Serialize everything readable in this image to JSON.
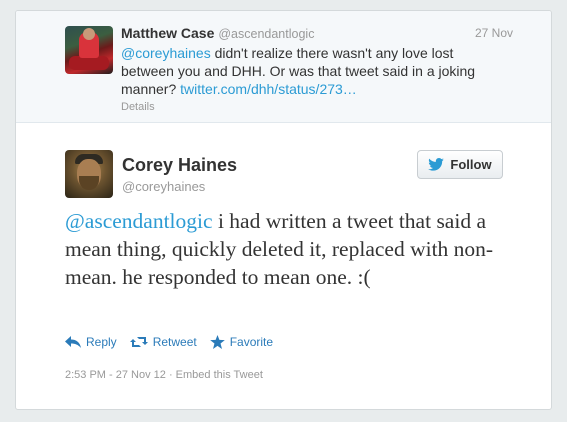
{
  "parent_tweet": {
    "author_name": "Matthew Case",
    "author_handle": "@ascendantlogic",
    "date": "27 Nov",
    "mention": "@coreyhaines",
    "text": " didn't realize there wasn't any love lost between you and DHH. Or was that tweet said in a joking manner? ",
    "link": "twitter.com/dhh/status/273…",
    "details_label": "Details"
  },
  "main_tweet": {
    "author_name": "Corey Haines",
    "author_handle": "@coreyhaines",
    "follow_label": "Follow",
    "mention": "@ascendantlogic",
    "text": " i had written a tweet that said a mean thing, quickly deleted it, replaced with non-mean. he responded to mean one. :(",
    "actions": {
      "reply": "Reply",
      "retweet": "Retweet",
      "favorite": "Favorite"
    },
    "timestamp": "2:53 PM - 27 Nov 12",
    "separator": " · ",
    "embed_label": "Embed this Tweet"
  },
  "colors": {
    "link": "#2b9bd4",
    "action": "#2b7bb9",
    "background": "#e8eced"
  },
  "icons": [
    "reply-icon",
    "retweet-icon",
    "favorite-icon",
    "twitter-bird-icon"
  ]
}
